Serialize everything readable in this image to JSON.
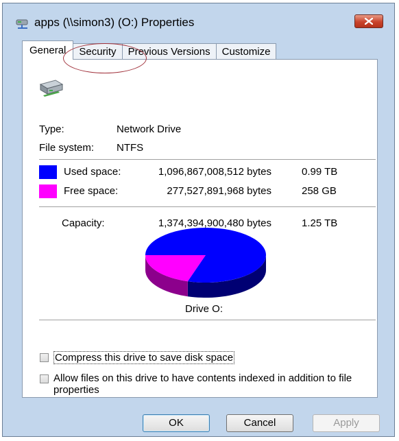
{
  "window": {
    "title": "apps (\\\\simon3) (O:) Properties"
  },
  "tabs": [
    {
      "label": "General"
    },
    {
      "label": "Security"
    },
    {
      "label": "Previous Versions"
    },
    {
      "label": "Customize"
    }
  ],
  "general": {
    "type_label": "Type:",
    "type_value": "Network Drive",
    "fs_label": "File system:",
    "fs_value": "NTFS",
    "used_label": "Used space:",
    "used_bytes": "1,096,867,008,512 bytes",
    "used_size": "0.99 TB",
    "free_label": "Free space:",
    "free_bytes": "277,527,891,968 bytes",
    "free_size": "258 GB",
    "capacity_label": "Capacity:",
    "capacity_bytes": "1,374,394,900,480 bytes",
    "capacity_size": "1.25 TB",
    "drive_label": "Drive O:",
    "used_fraction": 0.798,
    "used_color": "#0000ff",
    "free_color": "#ff00ff"
  },
  "options": {
    "compress_label": "Compress this drive to save disk space",
    "compress_checked": false,
    "index_label": "Allow files on this drive to have contents indexed in addition to file properties",
    "index_checked": false
  },
  "buttons": {
    "ok": "OK",
    "cancel": "Cancel",
    "apply": "Apply"
  }
}
